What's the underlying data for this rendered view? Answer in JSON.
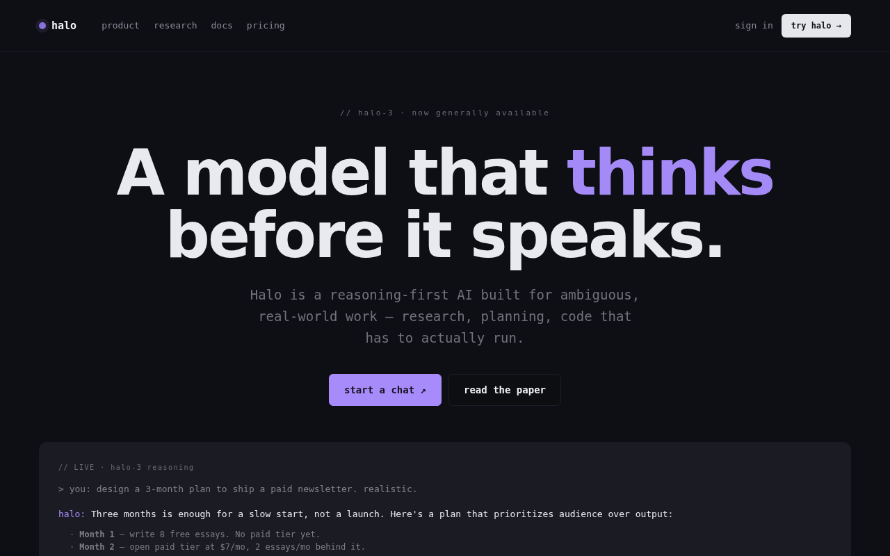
{
  "nav": {
    "logo": "halo",
    "links": [
      "product",
      "research",
      "docs",
      "pricing"
    ],
    "sign_in": "sign in",
    "cta": "try halo →"
  },
  "hero": {
    "eyebrow": "// halo-3 · now generally available",
    "headline": [
      {
        "segments": [
          {
            "text": "A model that ",
            "accent": false
          },
          {
            "text": "thinks",
            "accent": true
          }
        ]
      },
      {
        "segments": [
          {
            "text": "before it speaks.",
            "accent": false
          }
        ]
      }
    ],
    "subtitle": "Halo is a reasoning-first AI built for ambiguous, real-world work — research, planning, code that has to actually run.",
    "buttons": [
      {
        "label": "start a chat ↗",
        "kind": "primary"
      },
      {
        "label": "read the paper",
        "kind": "secondary"
      }
    ]
  },
  "demo": {
    "label": "// LIVE · halo-3 reasoning",
    "prompt": "> you: design a 3-month plan to ship a paid newsletter. realistic.",
    "reply": {
      "speaker": "halo:",
      "text": "Three months is enough for a slow start, not a launch. Here's a plan that prioritizes audience over output:"
    },
    "plan": [
      {
        "bullet": "·",
        "text": "**Month 1** — write 8 free essays. No paid tier yet."
      },
      {
        "bullet": "·",
        "text": "**Month 2** — open paid tier at $7/mo, 2 essays/mo behind it."
      }
    ]
  }
}
